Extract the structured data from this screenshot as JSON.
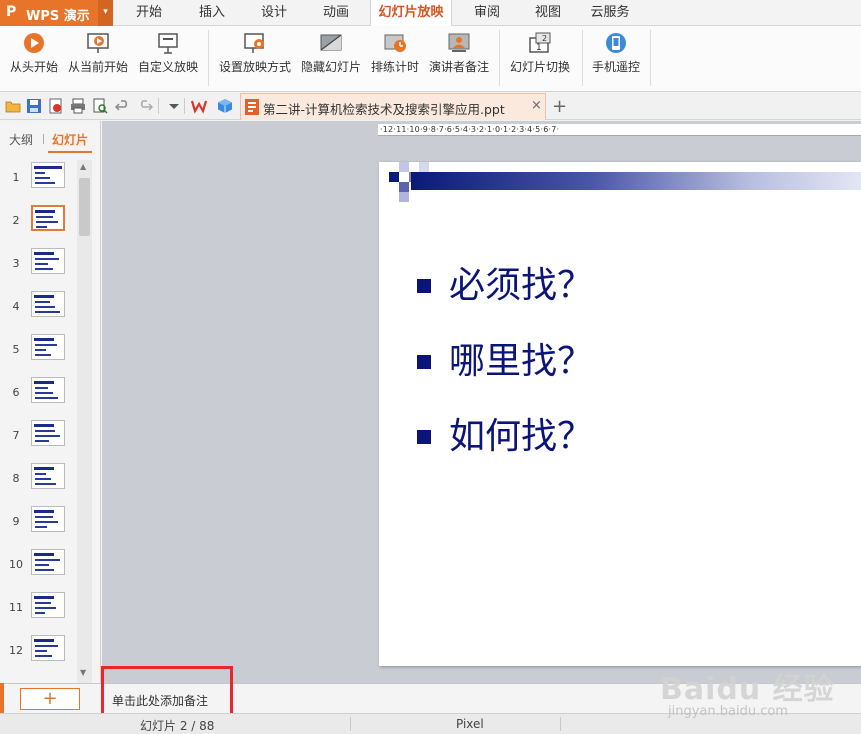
{
  "app": {
    "logo": "P",
    "name": "WPS 演示",
    "menu_arrow": "▾"
  },
  "tabs": [
    {
      "label": "开始",
      "active": false
    },
    {
      "label": "插入",
      "active": false
    },
    {
      "label": "设计",
      "active": false
    },
    {
      "label": "动画",
      "active": false
    },
    {
      "label": "幻灯片放映",
      "active": true
    },
    {
      "label": "审阅",
      "active": false
    },
    {
      "label": "视图",
      "active": false
    },
    {
      "label": "云服务",
      "active": false
    }
  ],
  "ribbon": {
    "from_start": {
      "label": "从头开始",
      "icon": "play-circle-icon"
    },
    "from_current": {
      "label": "从当前开始",
      "icon": "play-screen-icon"
    },
    "custom_show": {
      "label": "自定义放映",
      "icon": "projector-icon"
    },
    "setup_show": {
      "label": "设置放映方式",
      "icon": "gear-screen-icon"
    },
    "hide_slide": {
      "label": "隐藏幻灯片",
      "icon": "hide-slide-icon"
    },
    "rehearse": {
      "label": "排练计时",
      "icon": "clock-slide-icon"
    },
    "presenter_notes": {
      "label": "演讲者备注",
      "icon": "presenter-icon"
    },
    "slide_switch": {
      "label": "幻灯片切换",
      "icon": "switch-slide-icon"
    },
    "phone_remote": {
      "label": "手机遥控",
      "icon": "phone-remote-icon"
    }
  },
  "doc_tab": {
    "name": "第二讲-计算机检索技术及搜索引擎应用.ppt",
    "close": "×",
    "new": "+"
  },
  "left_panel": {
    "tab_outline": "大纲",
    "tab_slides": "幻灯片",
    "thumbs": [
      "1",
      "2",
      "3",
      "4",
      "5",
      "6",
      "7",
      "8",
      "9",
      "10",
      "11",
      "12"
    ],
    "selected": 2
  },
  "ruler": "·12·11·10·9·8·7·6·5·4·3·2·1·0·1·2·3·4·5·6·7·",
  "slide": {
    "bullets": [
      "必须找？",
      "哪里找？",
      "如何找？"
    ],
    "bullet_color": "#0b1478"
  },
  "notes": {
    "add_button": "+",
    "placeholder": "单击此处添加备注"
  },
  "status": {
    "slide_info": "幻灯片 2 / 88",
    "unit": "Pixel"
  },
  "watermark": {
    "brand": "Baidu 经验",
    "url": "jingyan.baidu.com"
  },
  "colors": {
    "accent": "#e8742a",
    "highlight": "#e8262b"
  }
}
